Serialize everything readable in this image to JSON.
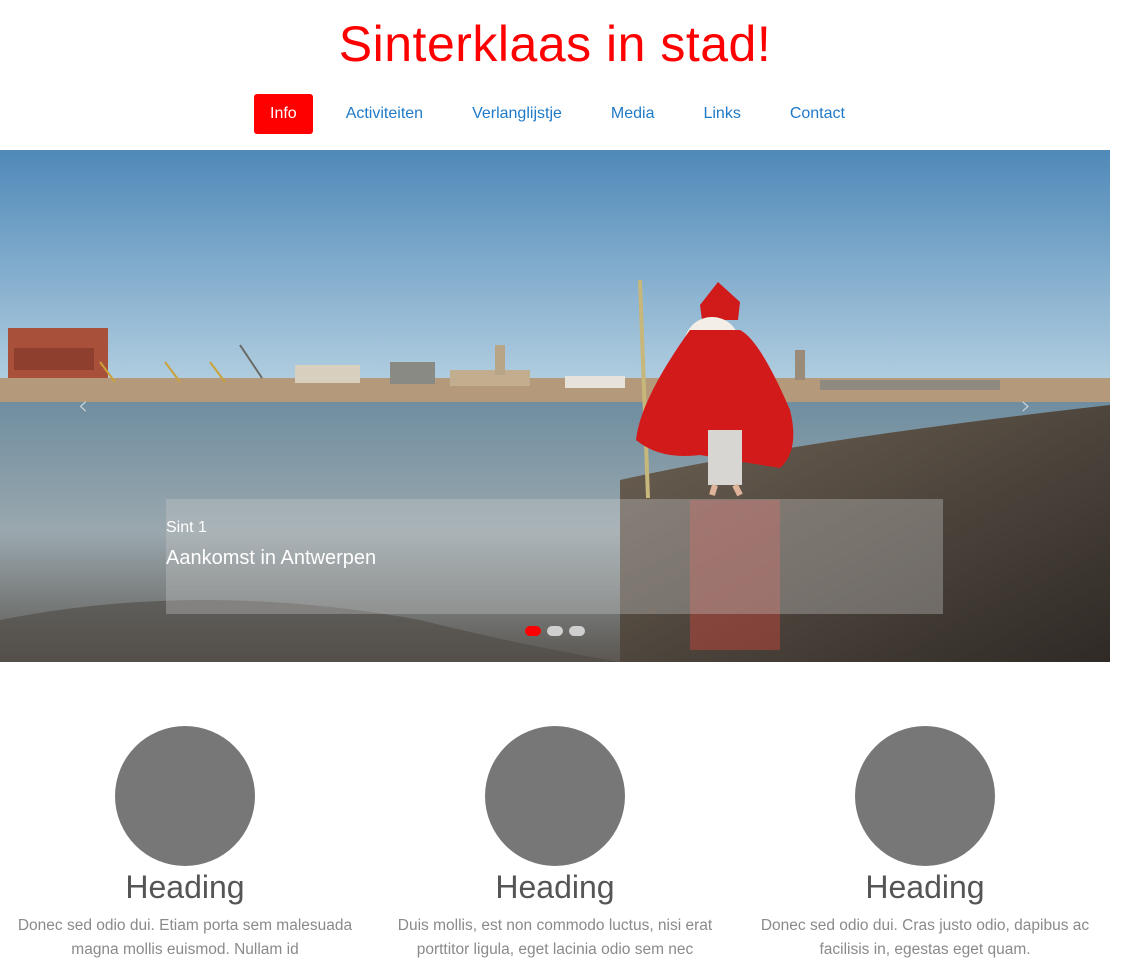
{
  "site": {
    "title": "Sinterklaas in stad!"
  },
  "nav": {
    "items": [
      {
        "label": "Info",
        "active": true
      },
      {
        "label": "Activiteiten",
        "active": false
      },
      {
        "label": "Verlanglijstje",
        "active": false
      },
      {
        "label": "Media",
        "active": false
      },
      {
        "label": "Links",
        "active": false
      },
      {
        "label": "Contact",
        "active": false
      }
    ]
  },
  "carousel": {
    "prev_icon": "chevron-left-icon",
    "next_icon": "chevron-right-icon",
    "caption": {
      "small": "Sint 1",
      "big": "Aankomst in Antwerpen"
    },
    "slide_count": 3,
    "active_index": 0
  },
  "features": [
    {
      "heading": "Heading",
      "text": "Donec sed odio dui. Etiam porta sem malesuada magna mollis euismod. Nullam id"
    },
    {
      "heading": "Heading",
      "text": "Duis mollis, est non commodo luctus, nisi erat porttitor ligula, eget lacinia odio sem nec"
    },
    {
      "heading": "Heading",
      "text": "Donec sed odio dui. Cras justo odio, dapibus ac facilisis in, egestas eget quam."
    }
  ],
  "colors": {
    "brand": "#ff0000",
    "link": "#1f7ac7",
    "placeholder": "#777777"
  }
}
